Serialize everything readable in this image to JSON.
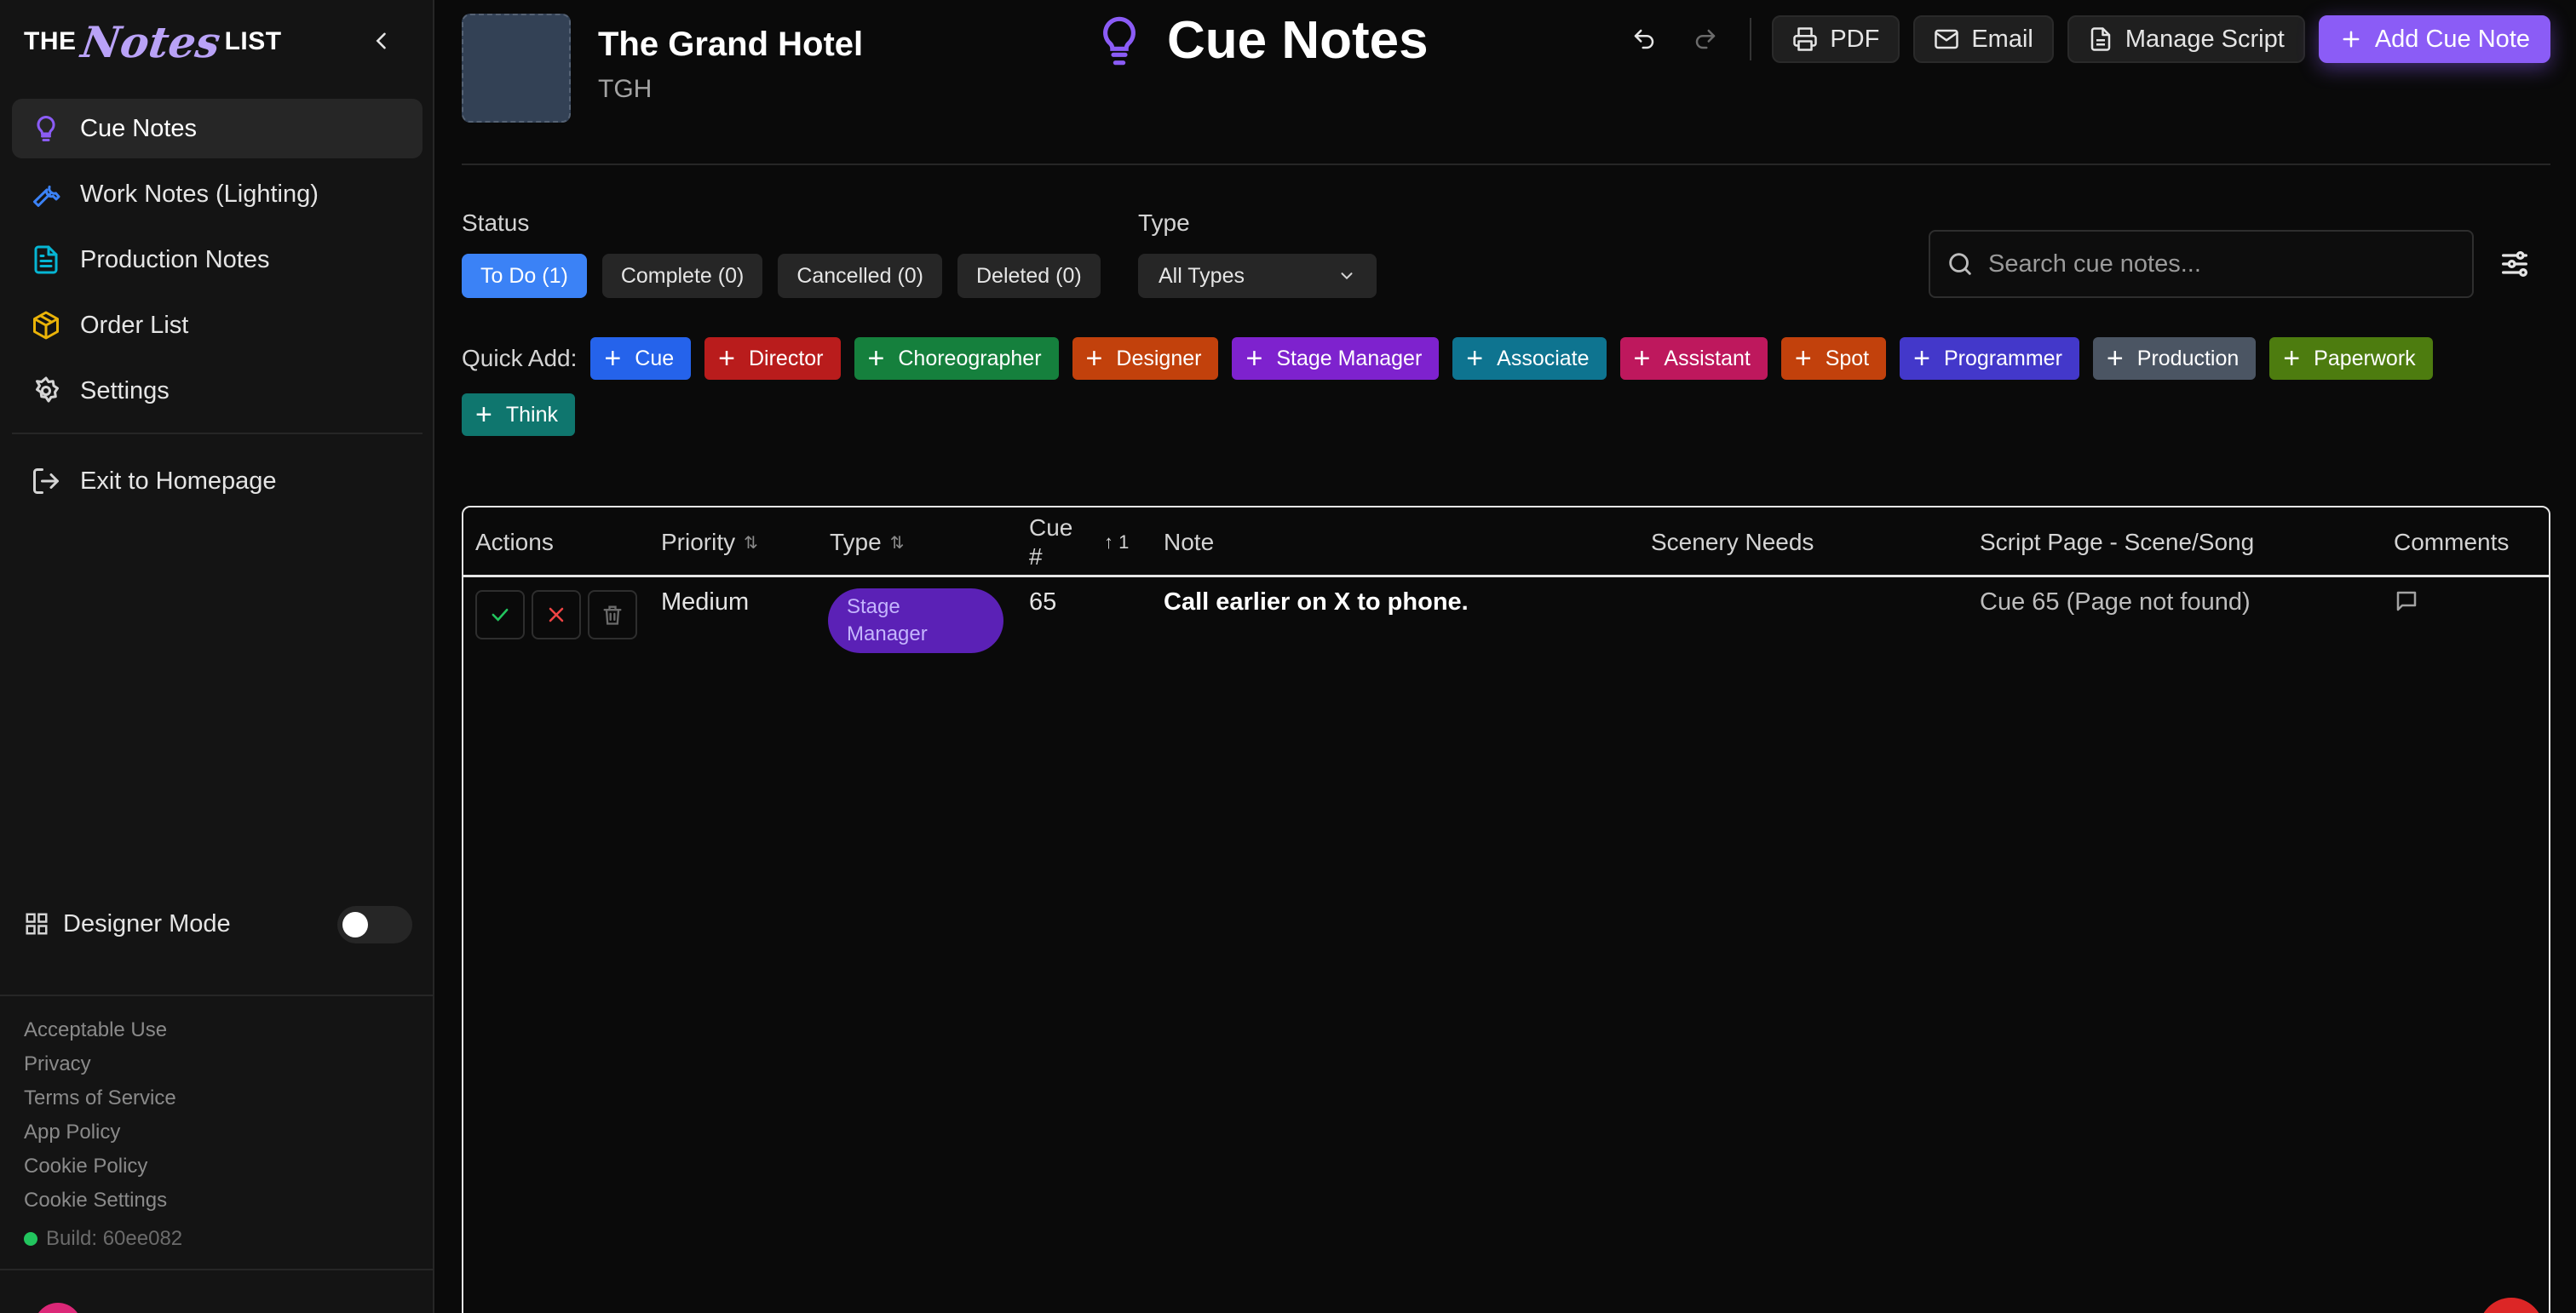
{
  "sidebar": {
    "logo": {
      "part1": "THE",
      "part2": "Notes",
      "part3": "LIST"
    },
    "nav": [
      {
        "label": "Cue Notes",
        "icon": "lightbulb-icon",
        "active": true
      },
      {
        "label": "Work Notes (Lighting)",
        "icon": "wrench-icon",
        "active": false
      },
      {
        "label": "Production Notes",
        "icon": "document-icon",
        "active": false
      },
      {
        "label": "Order List",
        "icon": "package-icon",
        "active": false
      },
      {
        "label": "Settings",
        "icon": "gear-icon",
        "active": false
      }
    ],
    "exit_label": "Exit to Homepage",
    "designer_mode_label": "Designer Mode",
    "designer_mode_on": false,
    "footer_links": [
      "Acceptable Use",
      "Privacy",
      "Terms of Service",
      "App Policy",
      "Cookie Policy",
      "Cookie Settings"
    ],
    "build": "Build: 60ee082"
  },
  "production": {
    "title": "The Grand Hotel",
    "abbreviation": "TGH"
  },
  "page_title": "Cue Notes",
  "toolbar": {
    "pdf": "PDF",
    "email": "Email",
    "manage_script": "Manage Script",
    "add_note": "Add Cue Note"
  },
  "filters": {
    "status_label": "Status",
    "status": [
      {
        "label": "To Do (1)",
        "active": true
      },
      {
        "label": "Complete (0)",
        "active": false
      },
      {
        "label": "Cancelled (0)",
        "active": false
      },
      {
        "label": "Deleted (0)",
        "active": false
      }
    ],
    "type_label": "Type",
    "type_value": "All Types",
    "search_placeholder": "Search cue notes..."
  },
  "quick_add": {
    "label": "Quick Add:",
    "buttons": [
      {
        "label": "Cue",
        "color": "#2563eb"
      },
      {
        "label": "Director",
        "color": "#b91c1c"
      },
      {
        "label": "Choreographer",
        "color": "#15803d"
      },
      {
        "label": "Designer",
        "color": "#c2410c"
      },
      {
        "label": "Stage Manager",
        "color": "#7e22ce"
      },
      {
        "label": "Associate",
        "color": "#0e7490"
      },
      {
        "label": "Assistant",
        "color": "#be185d"
      },
      {
        "label": "Spot",
        "color": "#c2410c"
      },
      {
        "label": "Programmer",
        "color": "#4338ca"
      },
      {
        "label": "Production",
        "color": "#4b5563"
      },
      {
        "label": "Paperwork",
        "color": "#4d7c0f"
      },
      {
        "label": "Think",
        "color": "#0f766e"
      }
    ]
  },
  "table": {
    "headers": {
      "actions": "Actions",
      "priority": "Priority",
      "type": "Type",
      "cue_line1": "Cue",
      "cue_line2": "#",
      "cue_sort": "↑ 1",
      "note": "Note",
      "scenery": "Scenery Needs",
      "script_page": "Script Page - Scene/Song",
      "comments": "Comments"
    },
    "rows": [
      {
        "priority": "Medium",
        "type_line1": "Stage",
        "type_line2": "Manager",
        "cue": "65",
        "note": "Call earlier on X to phone.",
        "scenery": "",
        "script_page": "Cue 65 (Page not found)"
      }
    ]
  }
}
